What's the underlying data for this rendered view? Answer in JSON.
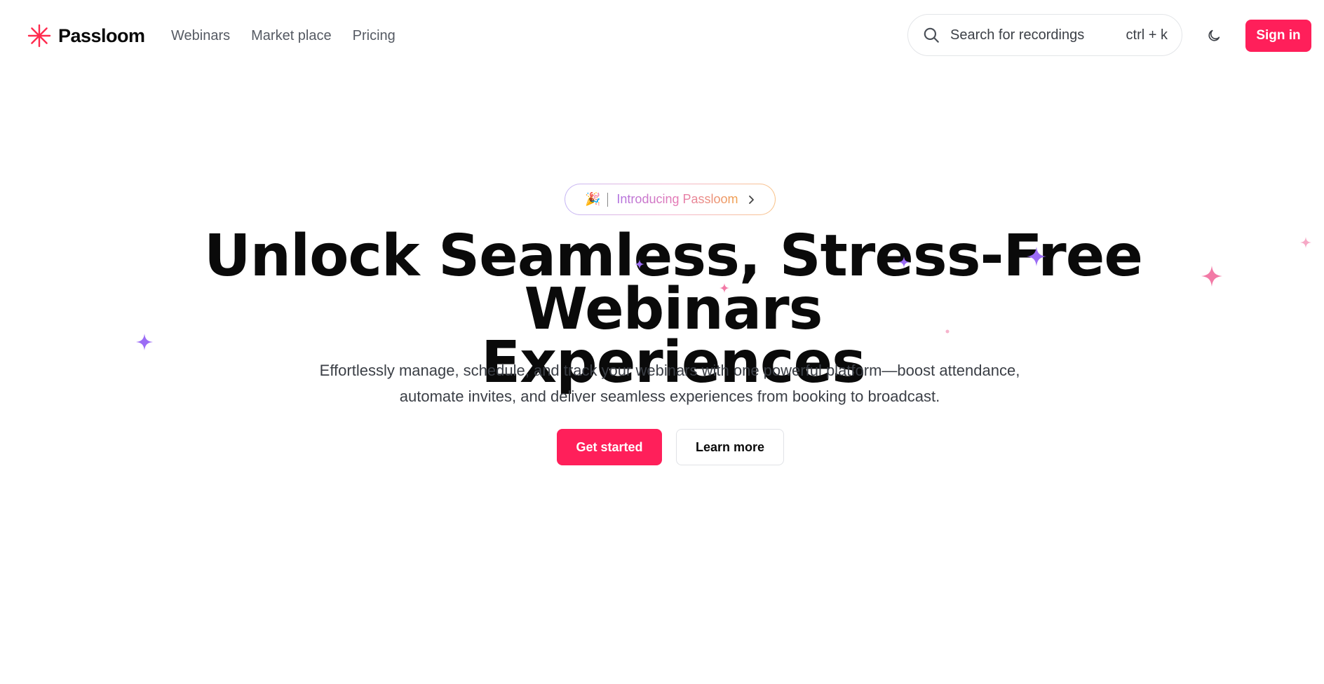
{
  "header": {
    "brand": "Passloom",
    "nav": [
      {
        "label": "Webinars"
      },
      {
        "label": "Market place"
      },
      {
        "label": "Pricing"
      }
    ],
    "search": {
      "placeholder": "Search for recordings",
      "shortcut": "ctrl + k"
    },
    "sign_in_label": "Sign in"
  },
  "hero": {
    "badge": {
      "emoji": "🎉",
      "text": "Introducing Passloom"
    },
    "headline_line1": "Unlock Seamless, Stress-Free Webinars",
    "headline_line2": "Experiences",
    "subtitle_line1": "Effortlessly manage, schedule, and track your webinars with one powerful platform—boost attendance,",
    "subtitle_line2": "automate invites, and deliver seamless experiences from booking to broadcast.",
    "primary_cta": "Get started",
    "secondary_cta": "Learn more"
  },
  "colors": {
    "accent": "#ff1f5a",
    "text_primary": "#0a0a0a",
    "text_secondary": "#3b3f46",
    "sparkle_purple": "#9b6cf5",
    "sparkle_pink": "#f27aa6"
  },
  "icons": {
    "logo": "asterisk-logo-icon",
    "search": "search-icon",
    "theme": "moon-icon",
    "badge_chevron": "chevron-right-icon"
  }
}
